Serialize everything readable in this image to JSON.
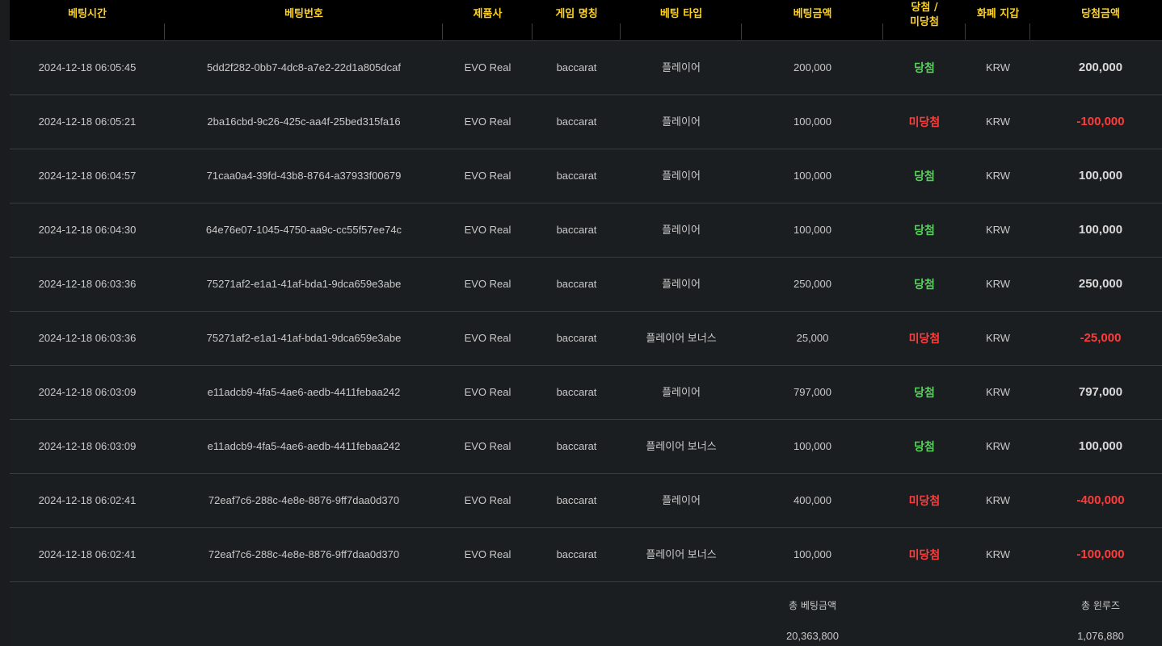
{
  "headers": {
    "bet_time": "베팅시간",
    "bet_id": "베팅번호",
    "provider": "제품사",
    "game_name": "게임 명칭",
    "bet_type": "베팅 타입",
    "bet_amount": "베팅금액",
    "result_line1": "당첨 /",
    "result_line2": "미당첨",
    "currency": "화폐 지갑",
    "win_amount": "당첨금액"
  },
  "rows": [
    {
      "time": "2024-12-18 06:05:45",
      "id": "5dd2f282-0bb7-4dc8-a7e2-22d1a805dcaf",
      "provider": "EVO Real",
      "game": "baccarat",
      "type": "플레이어",
      "amount": "200,000",
      "result": "당첨",
      "currency": "KRW",
      "win": "200,000",
      "status": "win"
    },
    {
      "time": "2024-12-18 06:05:21",
      "id": "2ba16cbd-9c26-425c-aa4f-25bed315fa16",
      "provider": "EVO Real",
      "game": "baccarat",
      "type": "플레이어",
      "amount": "100,000",
      "result": "미당첨",
      "currency": "KRW",
      "win": "-100,000",
      "status": "lose"
    },
    {
      "time": "2024-12-18 06:04:57",
      "id": "71caa0a4-39fd-43b8-8764-a37933f00679",
      "provider": "EVO Real",
      "game": "baccarat",
      "type": "플레이어",
      "amount": "100,000",
      "result": "당첨",
      "currency": "KRW",
      "win": "100,000",
      "status": "win"
    },
    {
      "time": "2024-12-18 06:04:30",
      "id": "64e76e07-1045-4750-aa9c-cc55f57ee74c",
      "provider": "EVO Real",
      "game": "baccarat",
      "type": "플레이어",
      "amount": "100,000",
      "result": "당첨",
      "currency": "KRW",
      "win": "100,000",
      "status": "win"
    },
    {
      "time": "2024-12-18 06:03:36",
      "id": "75271af2-e1a1-41af-bda1-9dca659e3abe",
      "provider": "EVO Real",
      "game": "baccarat",
      "type": "플레이어",
      "amount": "250,000",
      "result": "당첨",
      "currency": "KRW",
      "win": "250,000",
      "status": "win"
    },
    {
      "time": "2024-12-18 06:03:36",
      "id": "75271af2-e1a1-41af-bda1-9dca659e3abe",
      "provider": "EVO Real",
      "game": "baccarat",
      "type": "플레이어 보너스",
      "amount": "25,000",
      "result": "미당첨",
      "currency": "KRW",
      "win": "-25,000",
      "status": "lose"
    },
    {
      "time": "2024-12-18 06:03:09",
      "id": "e11adcb9-4fa5-4ae6-aedb-4411febaa242",
      "provider": "EVO Real",
      "game": "baccarat",
      "type": "플레이어",
      "amount": "797,000",
      "result": "당첨",
      "currency": "KRW",
      "win": "797,000",
      "status": "win"
    },
    {
      "time": "2024-12-18 06:03:09",
      "id": "e11adcb9-4fa5-4ae6-aedb-4411febaa242",
      "provider": "EVO Real",
      "game": "baccarat",
      "type": "플레이어 보너스",
      "amount": "100,000",
      "result": "당첨",
      "currency": "KRW",
      "win": "100,000",
      "status": "win"
    },
    {
      "time": "2024-12-18 06:02:41",
      "id": "72eaf7c6-288c-4e8e-8876-9ff7daa0d370",
      "provider": "EVO Real",
      "game": "baccarat",
      "type": "플레이어",
      "amount": "400,000",
      "result": "미당첨",
      "currency": "KRW",
      "win": "-400,000",
      "status": "lose"
    },
    {
      "time": "2024-12-18 06:02:41",
      "id": "72eaf7c6-288c-4e8e-8876-9ff7daa0d370",
      "provider": "EVO Real",
      "game": "baccarat",
      "type": "플레이어 보너스",
      "amount": "100,000",
      "result": "미당첨",
      "currency": "KRW",
      "win": "-100,000",
      "status": "lose"
    }
  ],
  "footer": {
    "total_bet_label": "총 베팅금액",
    "total_bet_value": "20,363,800",
    "total_winloss_label": "총 윈루즈",
    "total_winloss_value": "1,076,880"
  },
  "colors": {
    "header_text": "#ffd21f",
    "win": "#55d15a",
    "lose": "#ff3b3b"
  }
}
